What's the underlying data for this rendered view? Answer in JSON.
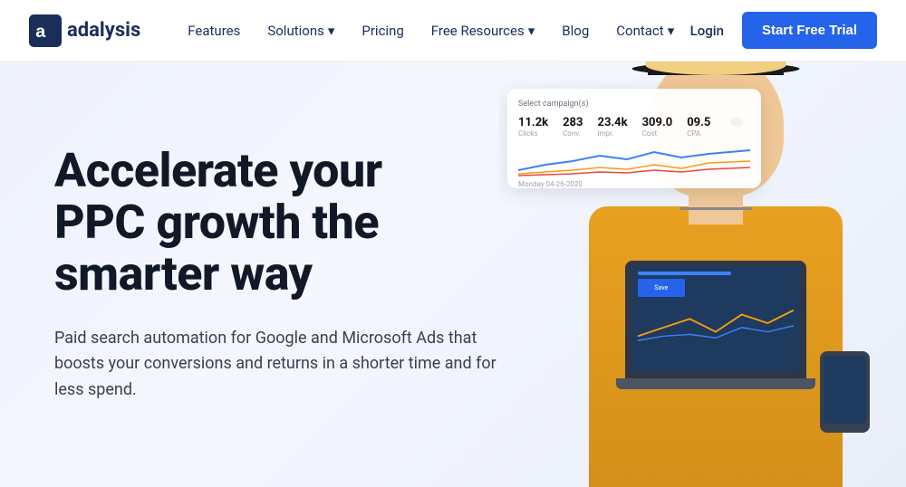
{
  "nav": {
    "logo_text": "adalysis",
    "links": [
      {
        "label": "Features",
        "has_dropdown": false
      },
      {
        "label": "Solutions",
        "has_dropdown": true
      },
      {
        "label": "Pricing",
        "has_dropdown": false
      },
      {
        "label": "Free Resources",
        "has_dropdown": true
      },
      {
        "label": "Blog",
        "has_dropdown": false
      },
      {
        "label": "Contact",
        "has_dropdown": true
      }
    ],
    "login_label": "Login",
    "cta_label": "Start Free Trial"
  },
  "hero": {
    "heading_line1": "Accelerate your",
    "heading_line2": "PPC growth the",
    "heading_line3": "smarter way",
    "subtext": "Paid search automation for Google and Microsoft Ads that boosts your conversions and returns in a shorter time and for less spend.",
    "dashboard": {
      "label": "Select campaign(s)",
      "metrics": [
        {
          "value": "11.2k",
          "label": "Clicks"
        },
        {
          "value": "283",
          "label": "Conv."
        },
        {
          "value": "23.4k",
          "label": "Impr."
        },
        {
          "value": "309.0",
          "label": "Cost"
        },
        {
          "value": "09.5",
          "label": "CPA"
        }
      ],
      "date_label": "Monday 04-26-2020"
    }
  },
  "icons": {
    "chevron_down": "▾",
    "logo_shape": "A"
  }
}
